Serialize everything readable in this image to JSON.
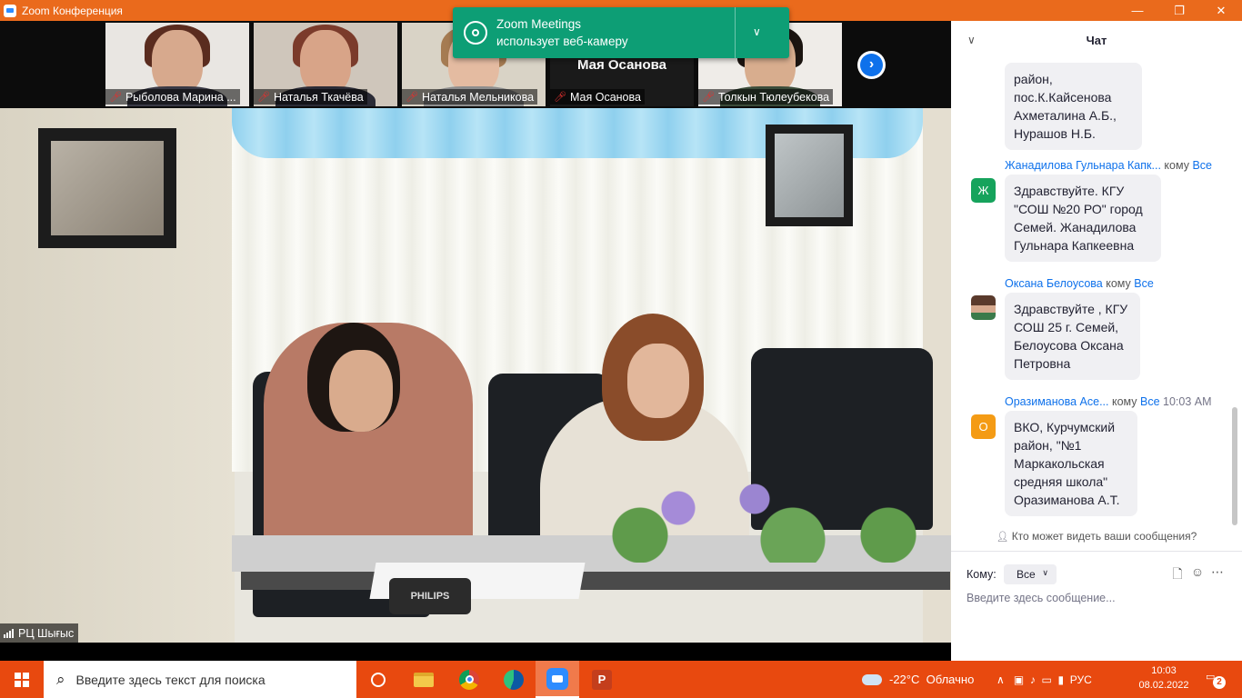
{
  "window": {
    "title": "Zoom Конференция",
    "controls": [
      "minimize-icon",
      "maximize-icon",
      "close-icon"
    ]
  },
  "gallery": {
    "participants": [
      {
        "name": "Рыболова Марина ...",
        "muted": true
      },
      {
        "name": "Наталья Ткачёва",
        "muted": true
      },
      {
        "name": "Наталья Мельникова",
        "muted": true
      },
      {
        "name": "Мая Осанова",
        "muted": true,
        "no_video_label": "Мая Осанова"
      },
      {
        "name": "Толкын Тюлеубекова",
        "muted": true
      }
    ]
  },
  "notification": {
    "line1": "Zoom Meetings",
    "line2": "использует веб-камеру"
  },
  "main_video": {
    "speaker": "РЦ Шығыс",
    "mic_brand": "PHILIPS"
  },
  "chat": {
    "title": "Чат",
    "messages": [
      {
        "text": "район,\nпос.К.Кайсенова\nАхметалина А.Б.,\nНурашов Н.Б."
      },
      {
        "sender": "Жанадилова Гульнара Капк...",
        "to_label": "кому",
        "to": "Все",
        "avatar_letter": "Ж",
        "avatar_color": "#16a35c",
        "text": "Здравствуйте. КГУ\n\"СОШ №20 РО\" город\nСемей. Жанадилова\nГульнара Капкеевна"
      },
      {
        "sender": "Оксана Белоусова",
        "to_label": "кому",
        "to": "Все",
        "avatar_letter": "",
        "text": "Здравствуйте , КГУ\nСОШ 25 г. Семей,\nБелоусова Оксана\nПетровна"
      },
      {
        "sender": "Оразиманова Асе...",
        "to_label": "кому",
        "to": "Все",
        "time": "10:03 AM",
        "avatar_letter": "О",
        "avatar_color": "#f49b15",
        "text": "ВКО, Курчумский\nрайон,  \"№1\nМаркакольская\nсредняя школа\"\nОразиманова А.Т."
      }
    ],
    "who_can_see": "Кто может видеть ваши сообщения?",
    "to_label": "Кому:",
    "to_value": "Все",
    "input_placeholder": "Введите здесь сообщение..."
  },
  "taskbar": {
    "search_placeholder": "Введите здесь текст для поиска",
    "apps": [
      "cortana-icon",
      "file-explorer-icon",
      "chrome-icon",
      "edge-icon",
      "zoom-icon",
      "powerpoint-icon"
    ],
    "weather": {
      "temp": "-22°C",
      "condition": "Облачно"
    },
    "language": "РУС",
    "time": "10:03",
    "date": "08.02.2022",
    "notifications": "2"
  },
  "colors": {
    "titlebar": "#ea6a1c",
    "taskbar": "#e8490f",
    "notification": "#0d9e75",
    "zoom_blue": "#0e71eb"
  }
}
